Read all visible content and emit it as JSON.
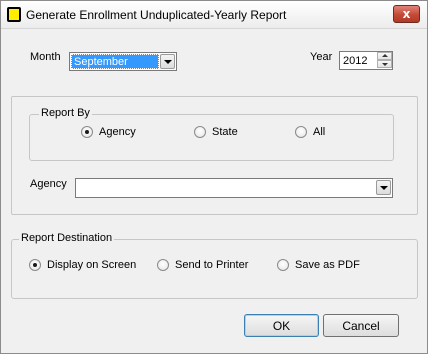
{
  "window": {
    "title": "Generate Enrollment Unduplicated-Yearly Report",
    "close_glyph": "x"
  },
  "month": {
    "label": "Month",
    "value": "September"
  },
  "year": {
    "label": "Year",
    "value": "2012"
  },
  "report_by": {
    "legend": "Report By",
    "options": [
      "Agency",
      "State",
      "All"
    ],
    "selected": "Agency"
  },
  "agency": {
    "label": "Agency",
    "value": ""
  },
  "report_destination": {
    "legend": "Report Destination",
    "options": [
      "Display on Screen",
      "Send to Printer",
      "Save as PDF"
    ],
    "selected": "Display on Screen"
  },
  "buttons": {
    "ok": "OK",
    "cancel": "Cancel"
  },
  "icons": {
    "app": "app-icon",
    "close": "close-icon",
    "dropdown": "chevron-down-icon",
    "spin_up": "spin-up-icon",
    "spin_down": "spin-down-icon"
  },
  "colors": {
    "selection": "#3399ff",
    "close_button": "#c44a37",
    "app_icon": "#ffee00"
  }
}
